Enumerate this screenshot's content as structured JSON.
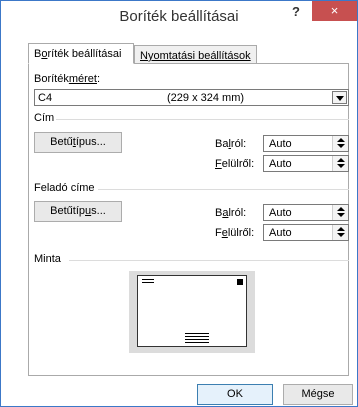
{
  "dialog": {
    "title": "Boríték beállításai",
    "help": "?",
    "close": "×"
  },
  "tabs": [
    {
      "label_pre": "B",
      "label_u": "o",
      "label_post": "ríték beállításai",
      "active": true
    },
    {
      "label_u": "N",
      "label_post": "yomtatási beállítások",
      "active": false
    }
  ],
  "envelope_size": {
    "label_pre": "Boríték",
    "label_u": "méret",
    "label_post": ":",
    "value_code": "C4",
    "value_dims": "(229 x 324 mm)"
  },
  "address": {
    "heading": "Cím",
    "font_button_pre": "Betű",
    "font_button_u": "t",
    "font_button_post": "ípus...",
    "from_left_pre": "Ba",
    "from_left_u": "l",
    "from_left_post": "ról:",
    "from_left_value": "Auto",
    "from_top_u": "F",
    "from_top_post": "elülről:",
    "from_top_value": "Auto"
  },
  "return_address": {
    "heading": "Feladó címe",
    "font_button_pre": "Betűtíp",
    "font_button_u": "u",
    "font_button_post": "s...",
    "from_left_pre": "B",
    "from_left_u": "a",
    "from_left_post": "lról:",
    "from_left_value": "Auto",
    "from_top_pre": "F",
    "from_top_u": "e",
    "from_top_post": "lülről:",
    "from_top_value": "Auto"
  },
  "preview": {
    "heading": "Minta"
  },
  "footer": {
    "ok": "OK",
    "cancel": "Mégse"
  }
}
